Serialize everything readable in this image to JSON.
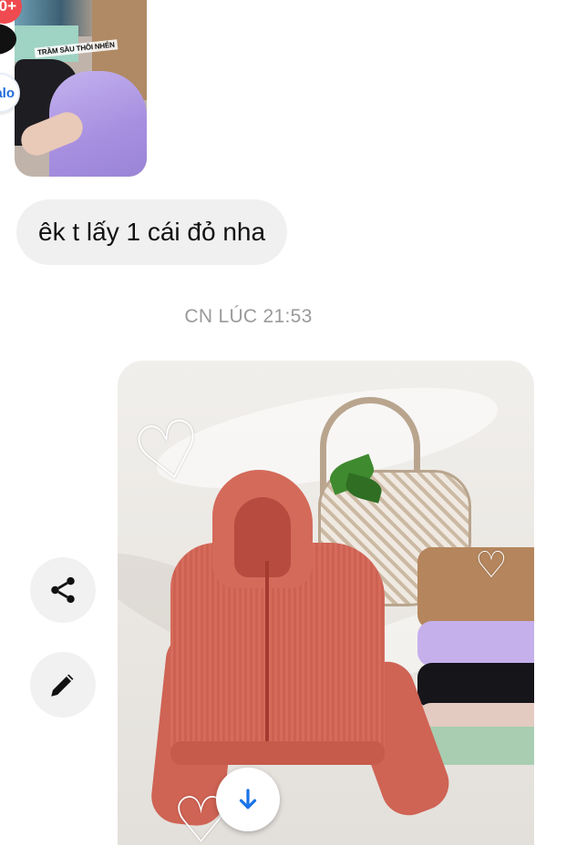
{
  "received_image": {
    "overlay_text": "TRẦM SẦU THÔI NHÉN"
  },
  "side_badges": {
    "notification_count": "0+",
    "zalo_label": "alo"
  },
  "messages": [
    {
      "text": "êk t lấy 1 cái đỏ nha"
    }
  ],
  "timestamp": "CN LÚC 21:53",
  "actions": {
    "share_icon": "share-icon",
    "edit_icon": "pencil-icon",
    "scroll_down_icon": "arrow-down-icon"
  },
  "colors": {
    "bubble_bg": "#f0f0f0",
    "timestamp": "#9a9a9a",
    "accent_blue": "#1a73e8",
    "badge_red": "#ef4a4f"
  }
}
